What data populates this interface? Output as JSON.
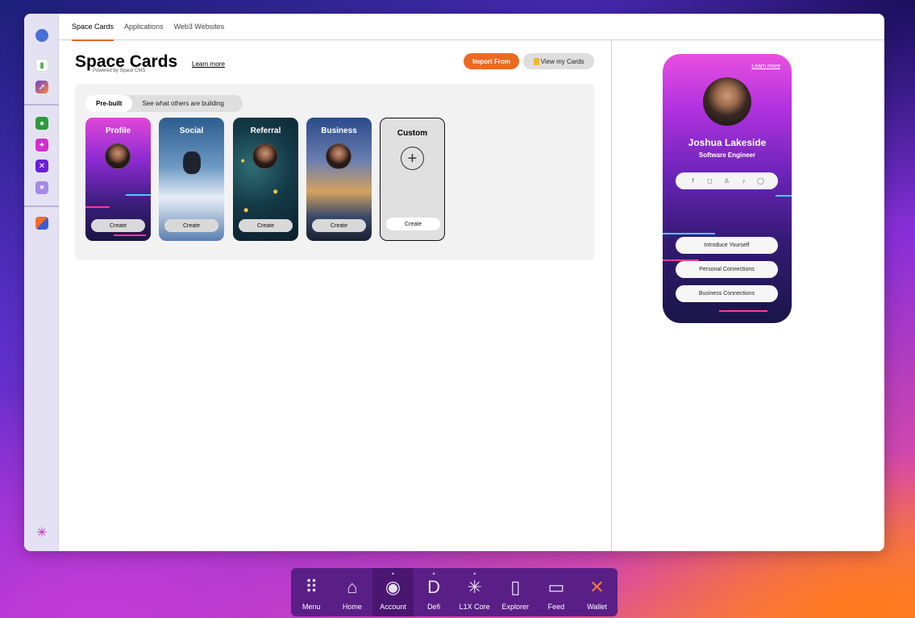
{
  "tabs": [
    "Space Cards",
    "Applications",
    "Web3 Websites"
  ],
  "header": {
    "title": "Space Cards",
    "subtitle": "Powered by Space CMS",
    "learn_more": "Learn more",
    "import_label": "Import From",
    "view_label": "View my Cards"
  },
  "segments": [
    "Pre-built",
    "See what others are building"
  ],
  "cards": [
    {
      "title": "Profile",
      "create": "Create"
    },
    {
      "title": "Social",
      "create": "Create"
    },
    {
      "title": "Referral",
      "create": "Create"
    },
    {
      "title": "Business",
      "create": "Create"
    },
    {
      "title": "Custom",
      "create": "Create"
    }
  ],
  "preview": {
    "learn_more": "Learn more",
    "name": "Joshua Lakeside",
    "role": "Software Engineer",
    "socials": [
      "facebook-icon",
      "instagram-icon",
      "snapchat-icon",
      "tiktok-icon",
      "whatsapp-icon"
    ],
    "buttons": [
      "Introduce Yourself",
      "Personal Connections",
      "Business Connections"
    ]
  },
  "dock": [
    {
      "label": "Menu",
      "icon": "grid-icon",
      "glyph": "⠿"
    },
    {
      "label": "Home",
      "icon": "home-icon",
      "glyph": "⌂"
    },
    {
      "label": "Account",
      "icon": "account-icon",
      "glyph": "◉"
    },
    {
      "label": "Defi",
      "icon": "defi-icon",
      "glyph": "D"
    },
    {
      "label": "L1X Core",
      "icon": "l1x-icon",
      "glyph": "✳"
    },
    {
      "label": "Explorer",
      "icon": "explorer-icon",
      "glyph": "▯"
    },
    {
      "label": "Feed",
      "icon": "feed-icon",
      "glyph": "▭"
    },
    {
      "label": "Wallet",
      "icon": "wallet-icon",
      "glyph": "✕"
    }
  ],
  "colors": {
    "accent": "#ec6a22",
    "dock": "#5a1f86"
  }
}
